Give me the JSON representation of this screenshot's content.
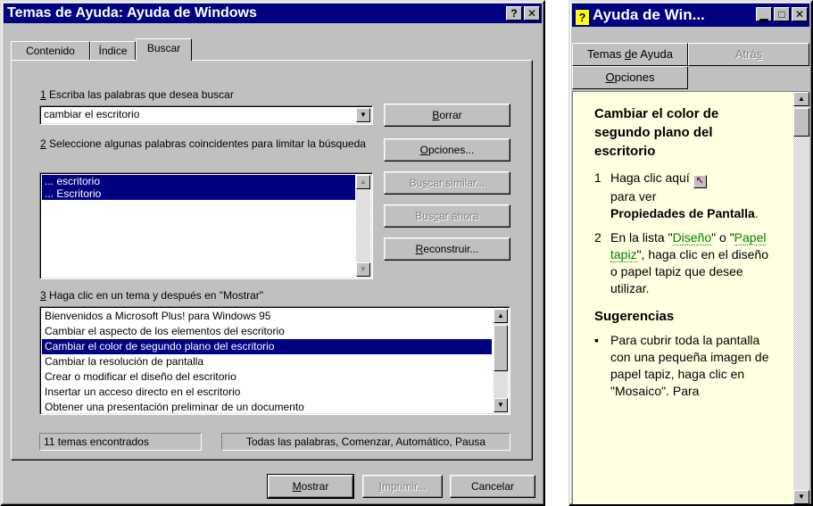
{
  "main_window": {
    "title": "Temas de Ayuda: Ayuda de Windows",
    "help_button": "?",
    "close_button": "✕",
    "tabs": [
      {
        "label": "Contenido",
        "active": false
      },
      {
        "label": "Índice",
        "active": false
      },
      {
        "label": "Buscar",
        "active": true
      }
    ],
    "step1": {
      "num": "1",
      "label": " Escriba las palabras que desea buscar",
      "input_value": "cambiar el escritorio"
    },
    "step2": {
      "num": "2",
      "label": "  Seleccione algunas palabras coincidentes para limitar la búsqueda",
      "words": [
        "... escritorio",
        "... Escritorio"
      ]
    },
    "step3": {
      "num": "3",
      "label": "  Haga clic en un tema y después en \"Mostrar\"",
      "topics": [
        "Bienvenidos a Microsoft Plus! para Windows 95",
        "Cambiar el aspecto de los elementos del escritorio",
        "Cambiar el color de segundo plano del escritorio",
        "Cambiar la resolución de pantalla",
        "Crear o modificar el diseño del escritorio",
        "Insertar un acceso directo en el escritorio",
        "Obtener una presentación preliminar de un documento"
      ],
      "selected_index": 2
    },
    "buttons": {
      "borrar_u": "B",
      "borrar_rest": "orrar",
      "opciones_u": "O",
      "opciones_rest": "pciones...",
      "similar_pre": "Bu",
      "similar_u": "s",
      "similar_rest": "car similar...",
      "ahora_pre": "Bus",
      "ahora_u": "c",
      "ahora_rest": "ar ahora",
      "reconstruir_u": "R",
      "reconstruir_rest": "econstruir...",
      "mostrar_u": "M",
      "mostrar_rest": "ostrar",
      "imprimir_u": "I",
      "imprimir_rest": "mprimir...",
      "cancelar": "Cancelar"
    },
    "status_left": "11 temas encontrados",
    "status_right": "Todas las palabras, Comenzar, Automático, Pausa"
  },
  "help_window": {
    "title": "Ayuda de Win...",
    "title_icon": "?",
    "btn_temas_pre": "Temas ",
    "btn_temas_u": "d",
    "btn_temas_rest": "e Ayuda",
    "btn_atras_pre": "Atrá",
    "btn_atras_u": "s",
    "btn_opciones_u": "O",
    "btn_opciones_rest": "pciones",
    "heading": "Cambiar el color de segundo plano del escritorio",
    "step1_num": "1",
    "step1_text": "Haga clic aquí",
    "step1_text2": "para ver",
    "step1_bold": "Propiedades de Pantalla",
    "step1_end": ".",
    "step2_num": "2",
    "step2_a": "En la lista \"",
    "step2_link1": "Diseño",
    "step2_b": "\" o \"",
    "step2_link2": "Papel tapiz",
    "step2_c": "\", haga clic en el diseño o papel tapiz que desee utilizar.",
    "sugerencias": "Sugerencias",
    "bullet": "▪",
    "tip": "Para cubrir toda la pantalla con una pequeña imagen de papel tapiz, haga clic en \"Mosaico\". Para"
  }
}
